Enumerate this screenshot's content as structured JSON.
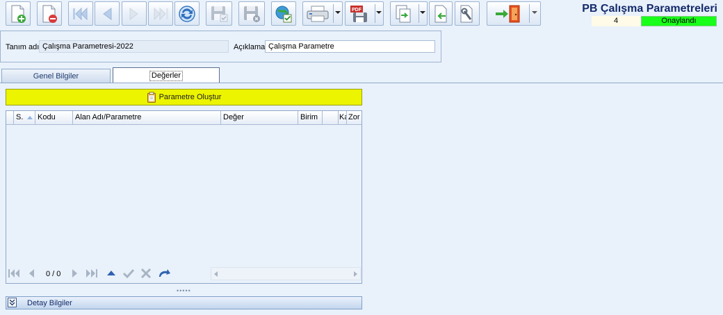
{
  "window": {
    "title": "PB Çalışma Parametreleri",
    "record_number": "4",
    "status": "Onaylandı",
    "status_color": "#19ff19"
  },
  "toolbar": [
    {
      "name": "new-document-icon"
    },
    {
      "name": "delete-document-icon"
    },
    {
      "name": "first-record-icon"
    },
    {
      "name": "previous-record-icon"
    },
    {
      "name": "next-record-icon"
    },
    {
      "name": "last-record-icon"
    },
    {
      "name": "refresh-icon"
    },
    {
      "name": "save-icon"
    },
    {
      "name": "cancel-save-icon"
    },
    {
      "name": "approve-icon"
    },
    {
      "name": "print-icon"
    },
    {
      "name": "pdf-export-icon"
    },
    {
      "name": "export-icon"
    },
    {
      "name": "import-icon"
    },
    {
      "name": "tools-icon"
    },
    {
      "name": "exit-icon"
    }
  ],
  "header": {
    "name_label": "Tanım adı",
    "name_value": "Çalışma Parametresi-2022",
    "desc_label": "Açıklama",
    "desc_value": "Çalışma Parametre"
  },
  "tabs": [
    {
      "label": "Genel Bilgiler",
      "active": false
    },
    {
      "label": "Değerler",
      "active": true
    }
  ],
  "values_tab": {
    "create_button_label": "Parametre Oluştur",
    "create_button_color": "#ecf400",
    "columns": [
      "S.",
      "Kodu",
      "Alan Adı/Parametre",
      "Değer",
      "Birim",
      "",
      "Ka",
      "Zor"
    ],
    "rows": [],
    "navigator": {
      "position": "0 / 0"
    }
  },
  "detail_section": {
    "label": "Detay Bilgiler"
  }
}
